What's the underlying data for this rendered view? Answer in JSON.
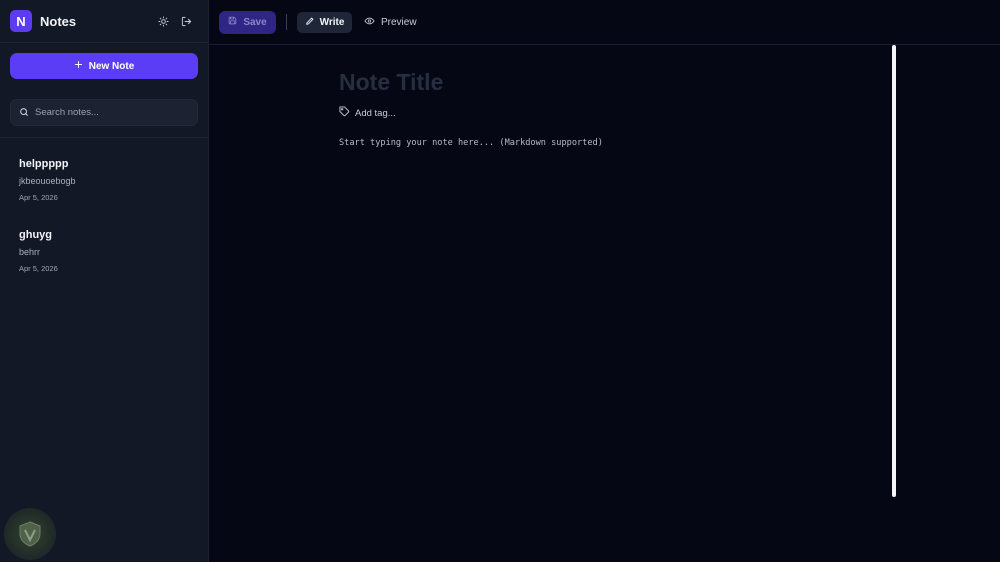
{
  "sidebar": {
    "logo_letter": "N",
    "app_name": "Notes",
    "theme_icon": "sun-icon",
    "logout_icon": "logout-icon",
    "new_note_label": "New Note",
    "search": {
      "placeholder": "Search notes..."
    },
    "notes": [
      {
        "title": "helppppp",
        "preview": "jkbeouoebogb",
        "date": "Apr 5, 2026"
      },
      {
        "title": "ghuyg",
        "preview": "behrr",
        "date": "Apr 5, 2026"
      }
    ]
  },
  "toolbar": {
    "save_label": "Save",
    "write_label": "Write",
    "preview_label": "Preview"
  },
  "editor": {
    "title_placeholder": "Note Title",
    "add_tag_label": "Add tag...",
    "body_placeholder": "Start typing your note here... (Markdown supported)"
  },
  "colors": {
    "accent": "#5b3df5",
    "sidebar_bg": "#121826",
    "main_bg": "#050814"
  }
}
